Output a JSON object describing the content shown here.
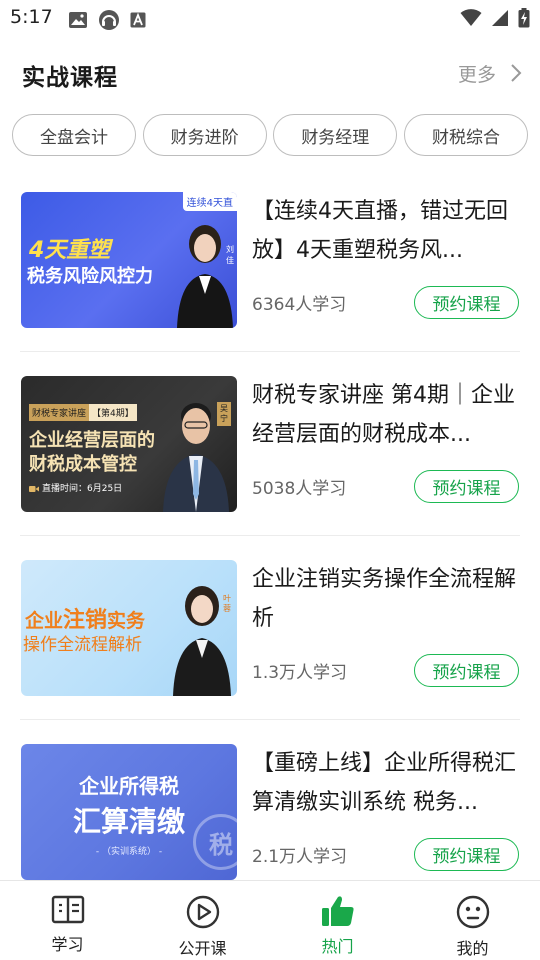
{
  "status_bar": {
    "time": "5:17"
  },
  "section": {
    "title": "实战课程",
    "more_label": "更多"
  },
  "chips": [
    "全盘会计",
    "财务进阶",
    "财务经理",
    "财税综合"
  ],
  "courses": [
    {
      "title": "【连续4天直播，错过无回放】4天重塑税务风...",
      "learners": "6364人学习",
      "reserve_label": "预约课程",
      "thumb_badge": "连续4天直",
      "thumb_line1": "4天重塑",
      "thumb_line2": "税务风险风控力",
      "thumb_name": "刘佳"
    },
    {
      "title": "财税专家讲座 第4期｜企业经营层面的财税成本...",
      "learners": "5038人学习",
      "reserve_label": "预约课程",
      "thumb_tag1": "财税专家讲座",
      "thumb_tag2": "【第4期】",
      "thumb_line1": "企业经营层面的",
      "thumb_line2": "财税成本管控",
      "thumb_time": "直播时间：6月25日",
      "thumb_name": "吴宁"
    },
    {
      "title": "企业注销实务操作全流程解析",
      "learners": "1.3万人学习",
      "reserve_label": "预约课程",
      "thumb_line1a": "企业",
      "thumb_line1b": "注销",
      "thumb_line1c": "实务",
      "thumb_line2": "操作全流程解析",
      "thumb_name": "叶蓉"
    },
    {
      "title": "【重磅上线】企业所得税汇算清缴实训系统 税务...",
      "learners": "2.1万人学习",
      "reserve_label": "预约课程",
      "thumb_line1": "企业所得税",
      "thumb_line2": "汇算清缴",
      "thumb_line3": "- （实训系统） -",
      "thumb_seal": "税"
    }
  ],
  "bottom_nav": [
    {
      "label": "学习",
      "icon": "book-icon"
    },
    {
      "label": "公开课",
      "icon": "play-circle-icon"
    },
    {
      "label": "热门",
      "icon": "thumbs-up-icon",
      "active": true
    },
    {
      "label": "我的",
      "icon": "profile-face-icon"
    }
  ],
  "colors": {
    "accent": "#16a34a",
    "chip_border": "#bdbdbd",
    "muted": "#999999"
  }
}
